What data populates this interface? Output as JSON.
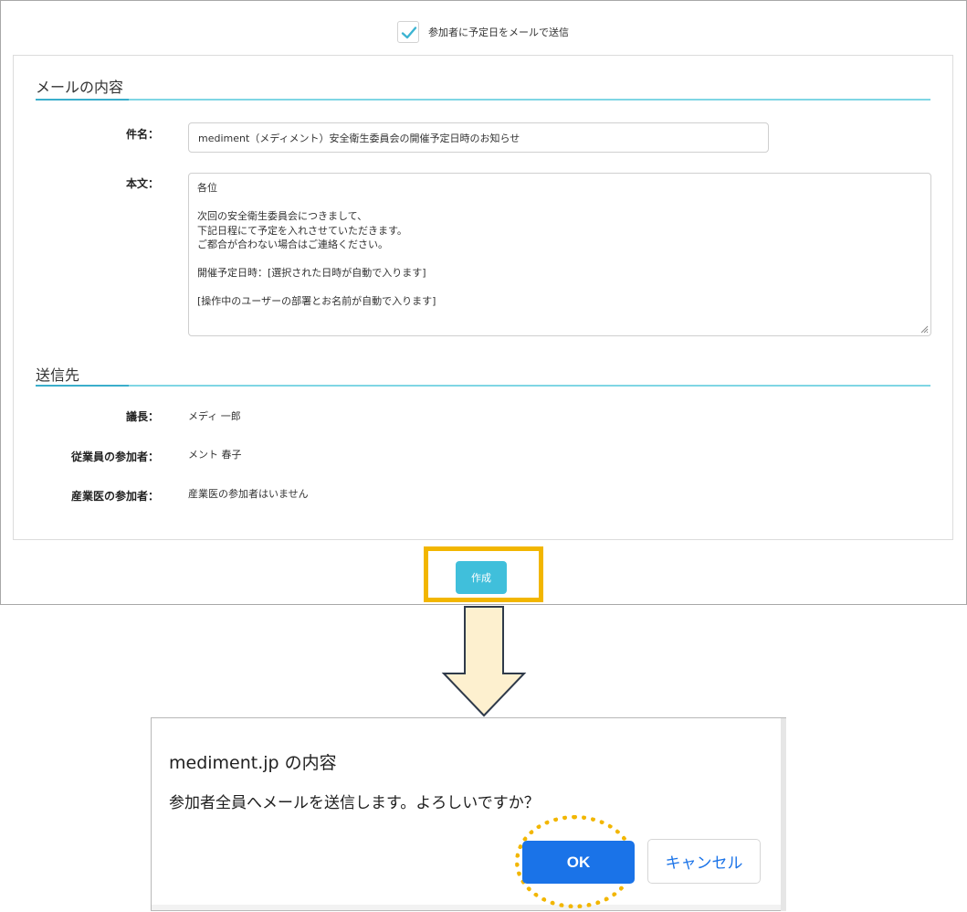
{
  "form": {
    "send_checkbox": {
      "checked": true,
      "label": "参加者に予定日をメールで送信"
    },
    "mail_section_title": "メールの内容",
    "subject": {
      "label": "件名：",
      "value": "mediment（メディメント）安全衛生委員会の開催予定日時のお知らせ"
    },
    "body": {
      "label": "本文：",
      "lines": [
        "各位",
        "",
        "次回の安全衛生委員会につきまして、",
        "下記日程にて予定を入れさせていただきます。",
        "ご都合が合わない場合はご連絡ください。",
        "",
        "開催予定日時：[選択された日時が自動で入ります]",
        "",
        "[操作中のユーザーの部署とお名前が自動で入ります]"
      ]
    },
    "recipients_section_title": "送信先",
    "recipients": [
      {
        "label": "議長：",
        "value": "メディ 一郎"
      },
      {
        "label": "従業員の参加者：",
        "value": "メント 春子"
      },
      {
        "label": "産業医の参加者：",
        "value": "産業医の参加者はいません"
      }
    ],
    "create_button": "作成"
  },
  "dialog": {
    "title": "mediment.jp の内容",
    "message": "参加者全員へメールを送信します。よろしいですか？",
    "ok_label": "OK",
    "cancel_label": "キャンセル"
  },
  "colors": {
    "accent": "#40bfdb",
    "highlight": "#f2b600",
    "dialog_primary": "#1a73e8",
    "arrow_fill": "#fdf0cf"
  }
}
